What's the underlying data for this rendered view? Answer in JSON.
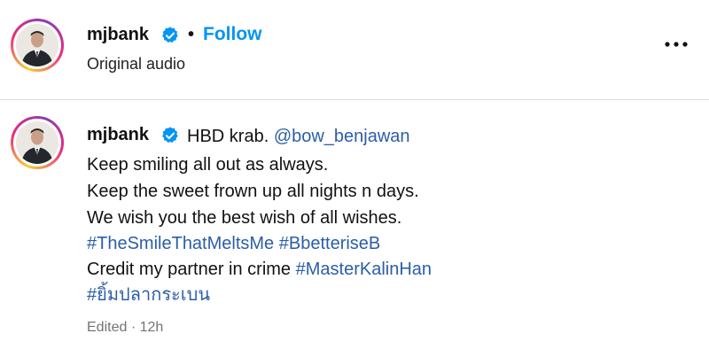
{
  "header": {
    "username": "mjbank",
    "separator": "•",
    "follow_label": "Follow",
    "subtitle": "Original audio",
    "more_icon": "more-horizontal-icon"
  },
  "comment": {
    "username": "mjbank",
    "first_text": "HBD krab.",
    "mention": "@bow_benjawan",
    "line2": "Keep smiling all out as always.",
    "line3": "Keep the sweet frown up all nights n days.",
    "line4": "We wish you the best wish of all wishes.",
    "hashtag1": "#TheSmileThatMeltsMe",
    "hashtag2": "#BbetteriseB",
    "credit_text": "Credit my partner in crime",
    "hashtag3": "#MasterKalinHan",
    "hashtag4": "#ยิ้มปลากระเบน",
    "edited": "Edited",
    "meta_separator": "·",
    "time": "12h"
  },
  "colors": {
    "follow": "#0095f6",
    "link": "#2b5ea8",
    "verified": "#0095f6",
    "meta": "#737373"
  }
}
